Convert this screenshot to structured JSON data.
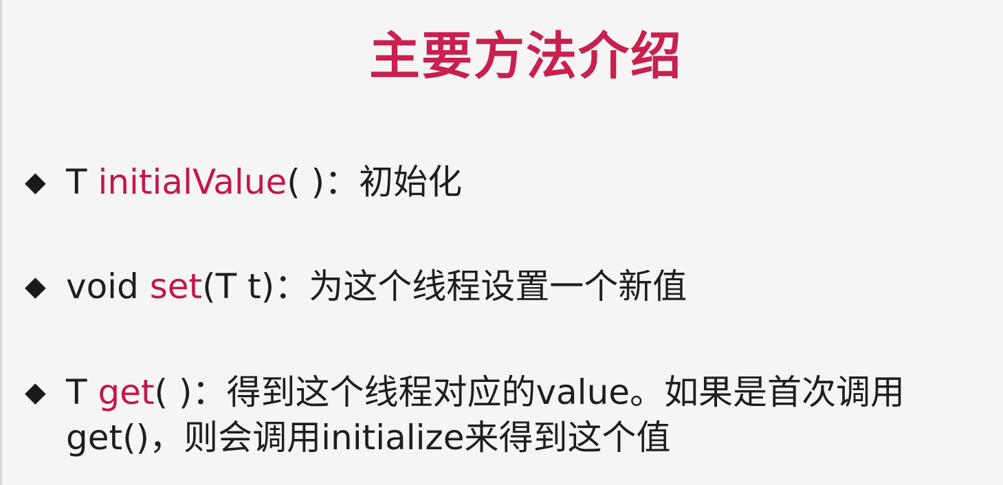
{
  "slide": {
    "title": "主要方法介绍",
    "bullet_glyph": "◆",
    "items": [
      {
        "prefix": "T ",
        "method": "initialValue",
        "suffix": "( )：初始化"
      },
      {
        "prefix": "void ",
        "method": "set",
        "suffix": "(T t)：为这个线程设置一个新值"
      },
      {
        "prefix": "T ",
        "method": "get",
        "suffix": "( )：得到这个线程对应的value。如果是首次调用",
        "continuation": "get()，则会调用initialize来得到这个值"
      }
    ]
  },
  "colors": {
    "title": "#c8204f",
    "method": "#c3174a",
    "text": "#1e1e1e",
    "background": "#f5f5f5"
  }
}
